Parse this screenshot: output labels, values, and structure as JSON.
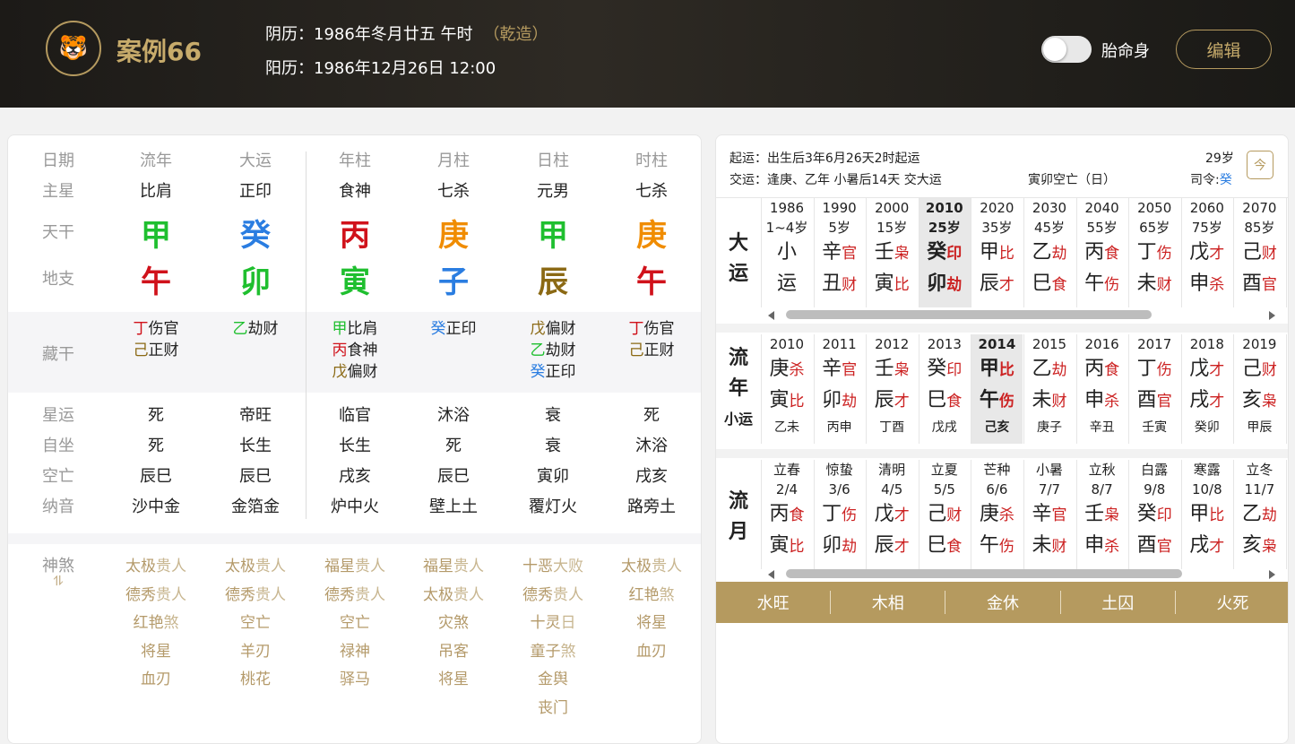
{
  "header": {
    "logo_icon": "tiger-icon",
    "title": "案例66",
    "lunar_date": "阴历：1986年冬月廿五 午时",
    "gender_tag": "（乾造）",
    "solar_date": "阳历：1986年12月26日 12:00",
    "toggle_label": "胎命身",
    "edit_label": "编辑"
  },
  "chart": {
    "labels": {
      "date": "日期",
      "zhuxing": "主星",
      "tiangan": "天干",
      "dizhi": "地支",
      "canggan": "藏干",
      "xingyun": "星运",
      "zizuo": "自坐",
      "kongwang": "空亡",
      "nayin": "纳音",
      "shensha": "神煞"
    },
    "columns": [
      {
        "head": "流年",
        "zhuxing": "比肩",
        "gan": "甲",
        "gan_color": "#1fbf2f",
        "zhi": "午",
        "zhi_color": "#d0121b",
        "hidden": [
          {
            "c": "丁",
            "col": "#d0121b",
            "t": "伤官"
          },
          {
            "c": "己",
            "col": "#8b6914",
            "t": "正财"
          }
        ],
        "xingyun": "死",
        "zizuo": "死",
        "kongwang": "辰巳",
        "nayin": "沙中金",
        "shensha": [
          "太极贵人",
          "德秀贵人",
          "红艳煞",
          "将星",
          "血刃"
        ]
      },
      {
        "head": "大运",
        "zhuxing": "正印",
        "gan": "癸",
        "gan_color": "#2a7de1",
        "zhi": "卯",
        "zhi_color": "#1fbf2f",
        "hidden": [
          {
            "c": "乙",
            "col": "#1fbf2f",
            "t": "劫财"
          }
        ],
        "xingyun": "帝旺",
        "zizuo": "长生",
        "kongwang": "辰巳",
        "nayin": "金箔金",
        "shensha": [
          "太极贵人",
          "德秀贵人",
          "空亡",
          "羊刃",
          "桃花"
        ]
      },
      {
        "head": "年柱",
        "zhuxing": "食神",
        "gan": "丙",
        "gan_color": "#d0121b",
        "zhi": "寅",
        "zhi_color": "#1fbf2f",
        "hidden": [
          {
            "c": "甲",
            "col": "#1fbf2f",
            "t": "比肩"
          },
          {
            "c": "丙",
            "col": "#d0121b",
            "t": "食神"
          },
          {
            "c": "戊",
            "col": "#8b6914",
            "t": "偏财"
          }
        ],
        "xingyun": "临官",
        "zizuo": "长生",
        "kongwang": "戌亥",
        "nayin": "炉中火",
        "shensha": [
          "福星贵人",
          "德秀贵人",
          "空亡",
          "禄神",
          "驿马"
        ]
      },
      {
        "head": "月柱",
        "zhuxing": "七杀",
        "gan": "庚",
        "gan_color": "#f08c00",
        "zhi": "子",
        "zhi_color": "#2a7de1",
        "hidden": [
          {
            "c": "癸",
            "col": "#2a7de1",
            "t": "正印"
          }
        ],
        "xingyun": "沐浴",
        "zizuo": "死",
        "kongwang": "辰巳",
        "nayin": "壁上土",
        "shensha": [
          "福星贵人",
          "太极贵人",
          "灾煞",
          "吊客",
          "将星"
        ]
      },
      {
        "head": "日柱",
        "zhuxing": "元男",
        "gan": "甲",
        "gan_color": "#1fbf2f",
        "zhi": "辰",
        "zhi_color": "#8b6914",
        "hidden": [
          {
            "c": "戊",
            "col": "#8b6914",
            "t": "偏财"
          },
          {
            "c": "乙",
            "col": "#1fbf2f",
            "t": "劫财"
          },
          {
            "c": "癸",
            "col": "#2a7de1",
            "t": "正印"
          }
        ],
        "xingyun": "衰",
        "zizuo": "衰",
        "kongwang": "寅卯",
        "nayin": "覆灯火",
        "shensha": [
          "十恶大败",
          "德秀贵人",
          "十灵日",
          "童子煞",
          "金舆",
          "丧门"
        ]
      },
      {
        "head": "时柱",
        "zhuxing": "七杀",
        "gan": "庚",
        "gan_color": "#f08c00",
        "zhi": "午",
        "zhi_color": "#d0121b",
        "hidden": [
          {
            "c": "丁",
            "col": "#d0121b",
            "t": "伤官"
          },
          {
            "c": "己",
            "col": "#8b6914",
            "t": "正财"
          }
        ],
        "xingyun": "死",
        "zizuo": "沐浴",
        "kongwang": "戌亥",
        "nayin": "路旁土",
        "shensha": [
          "太极贵人",
          "红艳煞",
          "将星",
          "血刃"
        ]
      }
    ]
  },
  "right": {
    "qiyun": "起运：出生后3年6月26天2时起运",
    "jiaoyun": "交运：逢庚、乙年 小暑后14天 交大运",
    "kongwang": "寅卯空亡（日）",
    "age": "29岁",
    "siling_label": "司令:",
    "siling_value": "癸",
    "calendar_icon": "今",
    "dayun_label": [
      "大",
      "运"
    ],
    "dayun": [
      {
        "y": "1986",
        "a": "1~4岁",
        "g": "小",
        "gs": "",
        "z": "运",
        "zs": ""
      },
      {
        "y": "1990",
        "a": "5岁",
        "g": "辛",
        "gs": "官",
        "z": "丑",
        "zs": "财"
      },
      {
        "y": "2000",
        "a": "15岁",
        "g": "壬",
        "gs": "枭",
        "z": "寅",
        "zs": "比"
      },
      {
        "y": "2010",
        "a": "25岁",
        "g": "癸",
        "gs": "印",
        "z": "卯",
        "zs": "劫",
        "sel": true
      },
      {
        "y": "2020",
        "a": "35岁",
        "g": "甲",
        "gs": "比",
        "z": "辰",
        "zs": "才"
      },
      {
        "y": "2030",
        "a": "45岁",
        "g": "乙",
        "gs": "劫",
        "z": "巳",
        "zs": "食"
      },
      {
        "y": "2040",
        "a": "55岁",
        "g": "丙",
        "gs": "食",
        "z": "午",
        "zs": "伤"
      },
      {
        "y": "2050",
        "a": "65岁",
        "g": "丁",
        "gs": "伤",
        "z": "未",
        "zs": "财"
      },
      {
        "y": "2060",
        "a": "75岁",
        "g": "戊",
        "gs": "才",
        "z": "申",
        "zs": "杀"
      },
      {
        "y": "2070",
        "a": "85岁",
        "g": "己",
        "gs": "财",
        "z": "酉",
        "zs": "官"
      }
    ],
    "liunian_label": [
      "流",
      "年"
    ],
    "xiaoyun_label": "小运",
    "liunian": [
      {
        "y": "2010",
        "g": "庚",
        "gs": "杀",
        "z": "寅",
        "zs": "比",
        "x": "乙未"
      },
      {
        "y": "2011",
        "g": "辛",
        "gs": "官",
        "z": "卯",
        "zs": "劫",
        "x": "丙申"
      },
      {
        "y": "2012",
        "g": "壬",
        "gs": "枭",
        "z": "辰",
        "zs": "才",
        "x": "丁酉"
      },
      {
        "y": "2013",
        "g": "癸",
        "gs": "印",
        "z": "巳",
        "zs": "食",
        "x": "戊戌"
      },
      {
        "y": "2014",
        "g": "甲",
        "gs": "比",
        "z": "午",
        "zs": "伤",
        "x": "己亥",
        "sel": true
      },
      {
        "y": "2015",
        "g": "乙",
        "gs": "劫",
        "z": "未",
        "zs": "财",
        "x": "庚子"
      },
      {
        "y": "2016",
        "g": "丙",
        "gs": "食",
        "z": "申",
        "zs": "杀",
        "x": "辛丑"
      },
      {
        "y": "2017",
        "g": "丁",
        "gs": "伤",
        "z": "酉",
        "zs": "官",
        "x": "壬寅"
      },
      {
        "y": "2018",
        "g": "戊",
        "gs": "才",
        "z": "戌",
        "zs": "才",
        "x": "癸卯"
      },
      {
        "y": "2019",
        "g": "己",
        "gs": "财",
        "z": "亥",
        "zs": "枭",
        "x": "甲辰"
      }
    ],
    "liuyue_label": [
      "流",
      "月"
    ],
    "liuyue": [
      {
        "n": "立春",
        "d": "2/4",
        "g": "丙",
        "gs": "食",
        "z": "寅",
        "zs": "比"
      },
      {
        "n": "惊蛰",
        "d": "3/6",
        "g": "丁",
        "gs": "伤",
        "z": "卯",
        "zs": "劫"
      },
      {
        "n": "清明",
        "d": "4/5",
        "g": "戊",
        "gs": "才",
        "z": "辰",
        "zs": "才"
      },
      {
        "n": "立夏",
        "d": "5/5",
        "g": "己",
        "gs": "财",
        "z": "巳",
        "zs": "食"
      },
      {
        "n": "芒种",
        "d": "6/6",
        "g": "庚",
        "gs": "杀",
        "z": "午",
        "zs": "伤"
      },
      {
        "n": "小暑",
        "d": "7/7",
        "g": "辛",
        "gs": "官",
        "z": "未",
        "zs": "财"
      },
      {
        "n": "立秋",
        "d": "8/7",
        "g": "壬",
        "gs": "枭",
        "z": "申",
        "zs": "杀"
      },
      {
        "n": "白露",
        "d": "9/8",
        "g": "癸",
        "gs": "印",
        "z": "酉",
        "zs": "官"
      },
      {
        "n": "寒露",
        "d": "10/8",
        "g": "甲",
        "gs": "比",
        "z": "戌",
        "zs": "才"
      },
      {
        "n": "立冬",
        "d": "11/7",
        "g": "乙",
        "gs": "劫",
        "z": "亥",
        "zs": "枭"
      }
    ],
    "wuxing": [
      "水旺",
      "木相",
      "金休",
      "土囚",
      "火死"
    ]
  }
}
